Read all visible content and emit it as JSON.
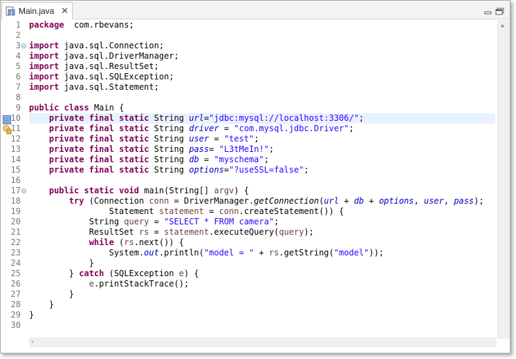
{
  "tab": {
    "title": "Main.java",
    "close": "✕"
  },
  "colors": {
    "keyword": "#7f0055",
    "string": "#2a00ff",
    "field": "#0000c0",
    "local_var": "#6a3e3e",
    "line_number": "#787878",
    "highlight": "#e8f2fe"
  },
  "icons": {
    "file": "java-file-icon",
    "minimize": "minimize-icon",
    "maximize": "maximize-icon",
    "bookmark": "bookmark-icon",
    "warning": "warning-icon"
  },
  "line_numbers": [
    "1",
    "2",
    "3",
    "4",
    "5",
    "6",
    "7",
    "8",
    "9",
    "10",
    "11",
    "12",
    "13",
    "14",
    "15",
    "16",
    "17",
    "18",
    "19",
    "20",
    "21",
    "22",
    "23",
    "24",
    "25",
    "26",
    "27",
    "28",
    "29",
    "30"
  ],
  "code": [
    [
      [
        "kw",
        "package"
      ],
      [
        "",
        "  com.rbevans;"
      ]
    ],
    [],
    [
      [
        "kw",
        "import"
      ],
      [
        "",
        " java.sql.Connection;"
      ]
    ],
    [
      [
        "kw",
        "import"
      ],
      [
        "",
        " java.sql.DriverManager;"
      ]
    ],
    [
      [
        "kw",
        "import"
      ],
      [
        "",
        " java.sql.ResultSet;"
      ]
    ],
    [
      [
        "kw",
        "import"
      ],
      [
        "",
        " java.sql.SQLException;"
      ]
    ],
    [
      [
        "kw",
        "import"
      ],
      [
        "",
        " java.sql.Statement;"
      ]
    ],
    [],
    [
      [
        "kw",
        "public"
      ],
      [
        "",
        " "
      ],
      [
        "kw",
        "class"
      ],
      [
        "",
        " Main {"
      ]
    ],
    [
      [
        "",
        "    "
      ],
      [
        "kw",
        "private"
      ],
      [
        "",
        " "
      ],
      [
        "kw",
        "final"
      ],
      [
        "",
        " "
      ],
      [
        "kw",
        "static"
      ],
      [
        "",
        " String "
      ],
      [
        "sfld",
        "url"
      ],
      [
        "",
        "="
      ],
      [
        "str",
        "\"jdbc:mysql://localhost:3306/\""
      ],
      [
        "",
        ";"
      ]
    ],
    [
      [
        "",
        "    "
      ],
      [
        "kw",
        "private"
      ],
      [
        "",
        " "
      ],
      [
        "kw",
        "final"
      ],
      [
        "",
        " "
      ],
      [
        "kw",
        "static"
      ],
      [
        "",
        " String "
      ],
      [
        "sfld",
        "driver"
      ],
      [
        "",
        " = "
      ],
      [
        "str",
        "\"com.mysql.jdbc.Driver\""
      ],
      [
        "",
        ";"
      ]
    ],
    [
      [
        "",
        "    "
      ],
      [
        "kw",
        "private"
      ],
      [
        "",
        " "
      ],
      [
        "kw",
        "final"
      ],
      [
        "",
        " "
      ],
      [
        "kw",
        "static"
      ],
      [
        "",
        " String "
      ],
      [
        "sfld",
        "user"
      ],
      [
        "",
        " = "
      ],
      [
        "str",
        "\"test\""
      ],
      [
        "",
        ";"
      ]
    ],
    [
      [
        "",
        "    "
      ],
      [
        "kw",
        "private"
      ],
      [
        "",
        " "
      ],
      [
        "kw",
        "final"
      ],
      [
        "",
        " "
      ],
      [
        "kw",
        "static"
      ],
      [
        "",
        " String "
      ],
      [
        "sfld",
        "pass"
      ],
      [
        "",
        "= "
      ],
      [
        "str",
        "\"L3tMeIn!\""
      ],
      [
        "",
        ";"
      ]
    ],
    [
      [
        "",
        "    "
      ],
      [
        "kw",
        "private"
      ],
      [
        "",
        " "
      ],
      [
        "kw",
        "final"
      ],
      [
        "",
        " "
      ],
      [
        "kw",
        "static"
      ],
      [
        "",
        " String "
      ],
      [
        "sfld",
        "db"
      ],
      [
        "",
        " = "
      ],
      [
        "str",
        "\"myschema\""
      ],
      [
        "",
        ";"
      ]
    ],
    [
      [
        "",
        "    "
      ],
      [
        "kw",
        "private"
      ],
      [
        "",
        " "
      ],
      [
        "kw",
        "final"
      ],
      [
        "",
        " "
      ],
      [
        "kw",
        "static"
      ],
      [
        "",
        " String "
      ],
      [
        "sfld",
        "options"
      ],
      [
        "",
        "="
      ],
      [
        "str",
        "\"?useSSL=false\""
      ],
      [
        "",
        ";"
      ]
    ],
    [],
    [
      [
        "",
        "    "
      ],
      [
        "kw",
        "public"
      ],
      [
        "",
        " "
      ],
      [
        "kw",
        "static"
      ],
      [
        "",
        " "
      ],
      [
        "kw",
        "void"
      ],
      [
        "",
        " main(String[] "
      ],
      [
        "lv",
        "argv"
      ],
      [
        "",
        ") {"
      ]
    ],
    [
      [
        "",
        "        "
      ],
      [
        "kw",
        "try"
      ],
      [
        "",
        " (Connection "
      ],
      [
        "lv",
        "conn"
      ],
      [
        "",
        " = DriverManager."
      ],
      [
        "it",
        "getConnection"
      ],
      [
        "",
        "("
      ],
      [
        "sfld",
        "url"
      ],
      [
        "",
        " + "
      ],
      [
        "sfld",
        "db"
      ],
      [
        "",
        " + "
      ],
      [
        "sfld",
        "options"
      ],
      [
        "",
        ", "
      ],
      [
        "sfld",
        "user"
      ],
      [
        "",
        ", "
      ],
      [
        "sfld",
        "pass"
      ],
      [
        "",
        ");"
      ]
    ],
    [
      [
        "",
        "                Statement "
      ],
      [
        "lv",
        "statement"
      ],
      [
        "",
        " = "
      ],
      [
        "lv",
        "conn"
      ],
      [
        "",
        ".createStatement()) {"
      ]
    ],
    [
      [
        "",
        "            String "
      ],
      [
        "lv",
        "query"
      ],
      [
        "",
        " = "
      ],
      [
        "str",
        "\"SELECT * FROM camera\""
      ],
      [
        "",
        ";"
      ]
    ],
    [
      [
        "",
        "            ResultSet "
      ],
      [
        "lv",
        "rs"
      ],
      [
        "",
        " = "
      ],
      [
        "lv",
        "statement"
      ],
      [
        "",
        ".executeQuery("
      ],
      [
        "lv",
        "query"
      ],
      [
        "",
        ");"
      ]
    ],
    [
      [
        "",
        "            "
      ],
      [
        "kw",
        "while"
      ],
      [
        "",
        " ("
      ],
      [
        "lv",
        "rs"
      ],
      [
        "",
        ".next()) {"
      ]
    ],
    [
      [
        "",
        "                System."
      ],
      [
        "sfld",
        "out"
      ],
      [
        "",
        ".println("
      ],
      [
        "str",
        "\"model = \""
      ],
      [
        "",
        " + "
      ],
      [
        "lv",
        "rs"
      ],
      [
        "",
        ".getString("
      ],
      [
        "str",
        "\"model\""
      ],
      [
        "",
        "));"
      ]
    ],
    [
      [
        "",
        "            }"
      ]
    ],
    [
      [
        "",
        "        } "
      ],
      [
        "kw",
        "catch"
      ],
      [
        "",
        " (SQLException "
      ],
      [
        "lv",
        "e"
      ],
      [
        "",
        ") {"
      ]
    ],
    [
      [
        "",
        "            "
      ],
      [
        "lv",
        "e"
      ],
      [
        "",
        ".printStackTrace();"
      ]
    ],
    [
      [
        "",
        "        }"
      ]
    ],
    [
      [
        "",
        "    }"
      ]
    ],
    [
      [
        "",
        "}"
      ]
    ],
    []
  ]
}
